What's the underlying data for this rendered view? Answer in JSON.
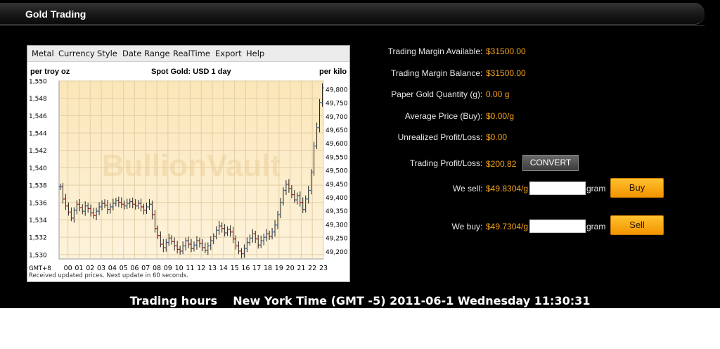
{
  "window": {
    "title": "Gold Trading"
  },
  "chart_menu": [
    "Metal",
    "Currency",
    "Style",
    "Date Range",
    "RealTime",
    "Export",
    "Help"
  ],
  "chart_data": {
    "type": "ohlc",
    "title": "Spot Gold: USD 1 day",
    "ylabel_left": "per troy oz",
    "ylabel_right": "per kilo",
    "watermark": "BullionVault",
    "timezone_label": "GMT+8",
    "categories": [
      "00",
      "01",
      "02",
      "03",
      "04",
      "05",
      "06",
      "07",
      "08",
      "09",
      "10",
      "11",
      "12",
      "13",
      "14",
      "15",
      "16",
      "17",
      "18",
      "19",
      "20",
      "21",
      "22",
      "23"
    ],
    "x_range": [
      -0.8,
      23.0
    ],
    "ylim_left": [
      1529.5,
      1550
    ],
    "left_ticks": [
      1550,
      1548,
      1546,
      1544,
      1542,
      1540,
      1538,
      1536,
      1534,
      1532,
      1530
    ],
    "right_ticks": [
      49800,
      49750,
      49700,
      49650,
      49600,
      49550,
      49500,
      49450,
      49400,
      49350,
      49300,
      49250,
      49200
    ],
    "ylim_right": [
      49172,
      49831
    ],
    "grid": true,
    "series": [
      {
        "values": [
          1537.8,
          1536.4,
          1535.6,
          1534.9,
          1534.2,
          1535.1,
          1535.8,
          1535.4,
          1535.0,
          1535.6,
          1535.3,
          1534.8,
          1534.5,
          1535.0,
          1535.5,
          1535.9,
          1535.7,
          1535.2,
          1535.5,
          1535.9,
          1536.2,
          1536.0,
          1535.8,
          1535.6,
          1535.9,
          1536.1,
          1535.8,
          1535.6,
          1535.9,
          1535.5,
          1535.1,
          1535.5,
          1535.8,
          1534.6,
          1533.0,
          1532.2,
          1531.2,
          1530.8,
          1531.4,
          1531.9,
          1531.5,
          1531.0,
          1530.6,
          1530.4,
          1531.0,
          1531.6,
          1531.2,
          1530.7,
          1531.1,
          1531.6,
          1531.3,
          1530.8,
          1530.5,
          1531.0,
          1531.6,
          1532.1,
          1532.8,
          1533.3,
          1533.0,
          1532.5,
          1532.9,
          1532.6,
          1531.8,
          1531.0,
          1530.4,
          1530.1,
          1530.7,
          1531.4,
          1531.9,
          1532.4,
          1531.8,
          1531.1,
          1531.6,
          1532.0,
          1532.4,
          1532.1,
          1532.6,
          1533.4,
          1534.6,
          1536.0,
          1537.4,
          1538.1,
          1537.6,
          1536.9,
          1536.3,
          1536.8,
          1536.0,
          1535.2,
          1536.4,
          1537.4,
          1539.5,
          1542.5,
          1544.6,
          1547.5,
          1549.2
        ]
      }
    ]
  },
  "chart_footer": "Received updated prices. Next update in 60 seconds.",
  "account": [
    {
      "label": "Trading Margin Available",
      "value": "$31500.00"
    },
    {
      "label": "Trading Margin Balance",
      "value": "$31500.00"
    },
    {
      "label": "Paper Gold Quantity (g)",
      "value": "0.00 g"
    },
    {
      "label": "Average Price (Buy)",
      "value": "$0.00/g"
    },
    {
      "label": "Unrealized Profit/Loss",
      "value": "$0.00"
    },
    {
      "label": "Trading Profit/Loss",
      "value": "$200.82"
    }
  ],
  "convert_label": "CONVERT",
  "sell_row": {
    "label": "We sell",
    "price": "$49.8304/g",
    "unit": "gram",
    "button": "Buy"
  },
  "buy_row": {
    "label": "We buy",
    "price": "$49.7304/g",
    "unit": "gram",
    "button": "Sell"
  },
  "colors": {
    "accent": "#f3a21c",
    "button": "#f7a20a",
    "chart_bg": "#fbecc7"
  },
  "footer": {
    "trading_hours": "Trading hours",
    "time_text": "New York Time (GMT -5) 2011-06-1 Wednesday 11:30:31"
  }
}
